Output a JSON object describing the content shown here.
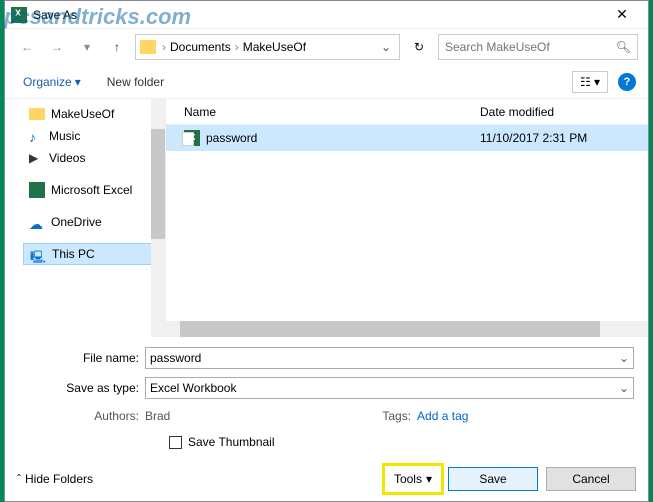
{
  "watermark": "pcsandtricks.com",
  "window": {
    "title": "Save As"
  },
  "nav": {
    "breadcrumb": [
      "Documents",
      "MakeUseOf"
    ],
    "search_placeholder": "Search MakeUseOf"
  },
  "toolbar": {
    "organize": "Organize",
    "new_folder": "New folder"
  },
  "tree": {
    "items": [
      {
        "icon": "folder",
        "label": "MakeUseOf"
      },
      {
        "icon": "music",
        "label": "Music"
      },
      {
        "icon": "video",
        "label": "Videos"
      }
    ],
    "excel": "Microsoft Excel",
    "onedrive": "OneDrive",
    "thispc": "This PC"
  },
  "filelist": {
    "col_name": "Name",
    "col_date": "Date modified",
    "rows": [
      {
        "name": "password",
        "date": "11/10/2017 2:31 PM"
      }
    ]
  },
  "fields": {
    "filename_label": "File name:",
    "filename_value": "password",
    "type_label": "Save as type:",
    "type_value": "Excel Workbook",
    "authors_label": "Authors:",
    "authors_value": "Brad",
    "tags_label": "Tags:",
    "tags_value": "Add a tag",
    "thumbnail_label": "Save Thumbnail"
  },
  "footer": {
    "hide_folders": "Hide Folders",
    "tools": "Tools",
    "save": "Save",
    "cancel": "Cancel"
  }
}
